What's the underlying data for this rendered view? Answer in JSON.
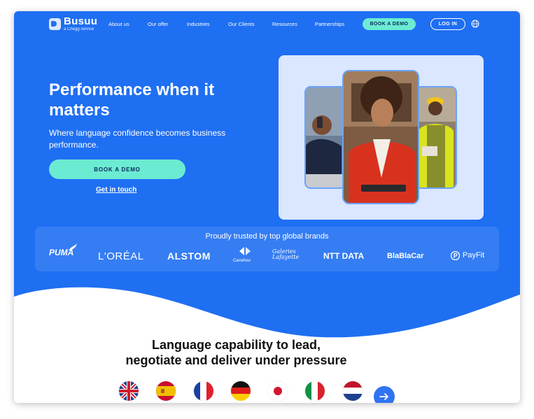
{
  "brand": {
    "name": "Busuu",
    "tagline": "a Chegg service"
  },
  "nav": {
    "items": [
      "About us",
      "Our offer",
      "Industries",
      "Our Clients",
      "Resources",
      "Partnerships"
    ],
    "demo_label": "BOOK A DEMO",
    "login_label": "LOG IN"
  },
  "hero": {
    "title": "Performance when it matters",
    "subtitle": "Where language confidence becomes business performance.",
    "cta_label": "BOOK A DEMO",
    "link_label": "Get in touch"
  },
  "trust": {
    "title": "Proudly trusted by top global brands",
    "brands": [
      "PUMA",
      "L'ORÉAL",
      "ALSTOM",
      "Carrefour",
      "Galeries Lafayette",
      "NTT DATA",
      "BlaBlaCar",
      "PayFit"
    ]
  },
  "section": {
    "title_line1": "Language capability to lead,",
    "title_line2": "negotiate and deliver under pressure"
  },
  "languages": [
    "English (UK)",
    "Spanish",
    "French",
    "German",
    "Japanese",
    "Italian",
    "Dutch"
  ],
  "colors": {
    "primary": "#1f6ff2",
    "accent": "#6cebd3",
    "text_dark": "#111111"
  },
  "icons": {
    "language_switch": "globe-icon",
    "next": "arrow-right-icon"
  }
}
